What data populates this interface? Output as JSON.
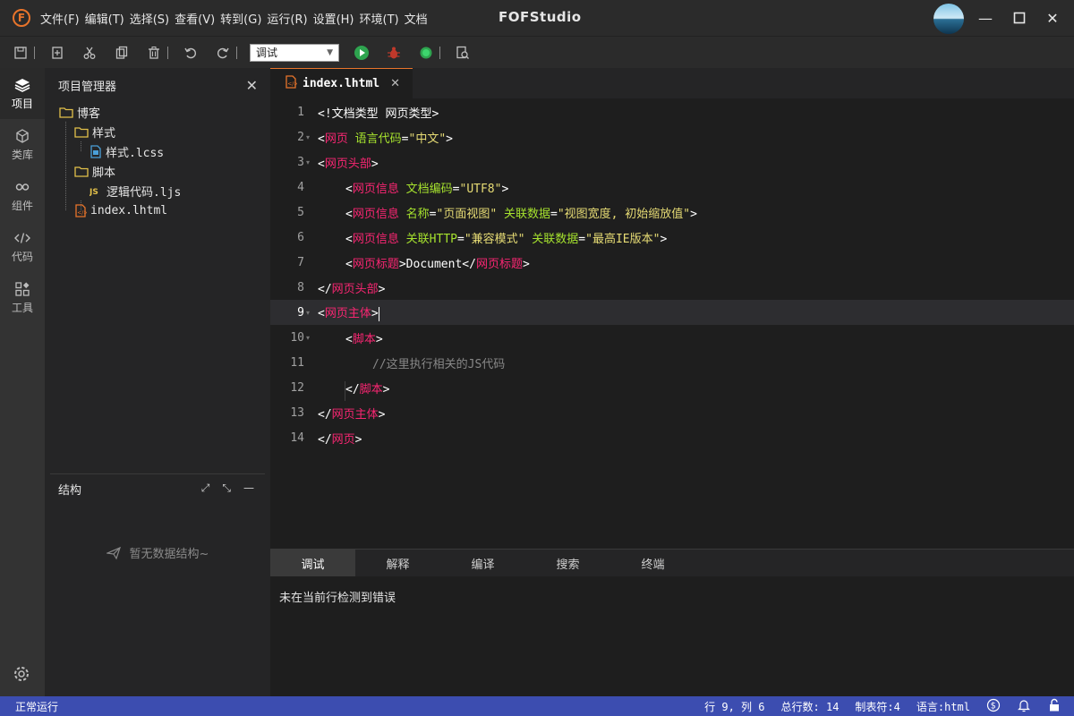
{
  "titlebar": {
    "logo_letter": "F",
    "menu": [
      "文件(F)",
      "编辑(T)",
      "选择(S)",
      "查看(V)",
      "转到(G)",
      "运行(R)",
      "设置(H)",
      "环境(T)",
      "文档"
    ],
    "app_title": "FOFStudio",
    "minimize": "—",
    "maximize": "☐",
    "close": "✕"
  },
  "toolbar": {
    "mode_select_value": "调试"
  },
  "activitybar": {
    "items": [
      {
        "label": "项目",
        "icon": "layers-icon"
      },
      {
        "label": "类库",
        "icon": "cube-icon"
      },
      {
        "label": "组件",
        "icon": "link-icon"
      },
      {
        "label": "代码",
        "icon": "code-icon"
      },
      {
        "label": "工具",
        "icon": "tools-icon"
      }
    ]
  },
  "sidebar": {
    "title": "项目管理器",
    "tree": [
      {
        "label": "博客",
        "type": "folder"
      },
      {
        "label": "样式",
        "type": "folder"
      },
      {
        "label": "样式.lcss",
        "type": "css"
      },
      {
        "label": "脚本",
        "type": "folder"
      },
      {
        "label": "逻辑代码.ljs",
        "type": "js"
      },
      {
        "label": "index.lhtml",
        "type": "html"
      }
    ],
    "structure_title": "结构",
    "structure_empty": "暂无数据结构~"
  },
  "editor": {
    "tab_label": "index.lhtml",
    "tab_close": "✕",
    "lines": [
      {
        "n": "1",
        "fold": false,
        "indent": 0
      },
      {
        "n": "2",
        "fold": true,
        "indent": 0
      },
      {
        "n": "3",
        "fold": true,
        "indent": 0
      },
      {
        "n": "4",
        "fold": false,
        "indent": 1
      },
      {
        "n": "5",
        "fold": false,
        "indent": 1
      },
      {
        "n": "6",
        "fold": false,
        "indent": 1
      },
      {
        "n": "7",
        "fold": false,
        "indent": 1
      },
      {
        "n": "8",
        "fold": false,
        "indent": 0
      },
      {
        "n": "9",
        "fold": true,
        "indent": 0
      },
      {
        "n": "10",
        "fold": true,
        "indent": 1
      },
      {
        "n": "11",
        "fold": false,
        "indent": 2
      },
      {
        "n": "12",
        "fold": false,
        "indent": 1
      },
      {
        "n": "13",
        "fold": false,
        "indent": 0
      },
      {
        "n": "14",
        "fold": false,
        "indent": 0
      }
    ],
    "code": {
      "l1": [
        "<!文档类型 网页类型>"
      ],
      "l2": [
        "<",
        "网页",
        " 语言代码",
        "=",
        "\"中文\"",
        ">"
      ],
      "l3": [
        "<",
        "网页头部",
        ">"
      ],
      "l4": [
        "<",
        "网页信息",
        " 文档编码",
        "=",
        "\"UTF8\"",
        ">"
      ],
      "l5": [
        "<",
        "网页信息",
        " 名称",
        "=",
        "\"页面视图\"",
        " 关联数据",
        "=",
        "\"视图宽度, 初始缩放值\"",
        ">"
      ],
      "l6": [
        "<",
        "网页信息",
        " 关联HTTP",
        "=",
        "\"兼容模式\"",
        " 关联数据",
        "=",
        "\"最高IE版本\"",
        ">"
      ],
      "l7": [
        "<",
        "网页标题",
        ">",
        "Document",
        "</",
        "网页标题",
        ">"
      ],
      "l8": [
        "</",
        "网页头部",
        ">"
      ],
      "l9": [
        "<",
        "网页主体",
        ">"
      ],
      "l10": [
        "<",
        "脚本",
        ">"
      ],
      "l11": [
        "//这里执行相关的JS代码"
      ],
      "l12": [
        "</",
        "脚本",
        ">"
      ],
      "l13": [
        "</",
        "网页主体",
        ">"
      ],
      "l14": [
        "</",
        "网页",
        ">"
      ]
    }
  },
  "bottompanel": {
    "tabs": [
      "调试",
      "解释",
      "编译",
      "搜索",
      "终端"
    ],
    "active_tab": "调试",
    "message": "未在当前行检测到错误"
  },
  "statusbar": {
    "left": "正常运行",
    "position": "行 9, 列 6",
    "total_lines": "总行数: 14",
    "tab_size": "制表符:4",
    "language": "语言:html"
  },
  "colors": {
    "accent": "#e8742b",
    "status_bar": "#3c4db0",
    "tag": "#f92672",
    "attr": "#a6e22e",
    "string": "#e6db74"
  }
}
